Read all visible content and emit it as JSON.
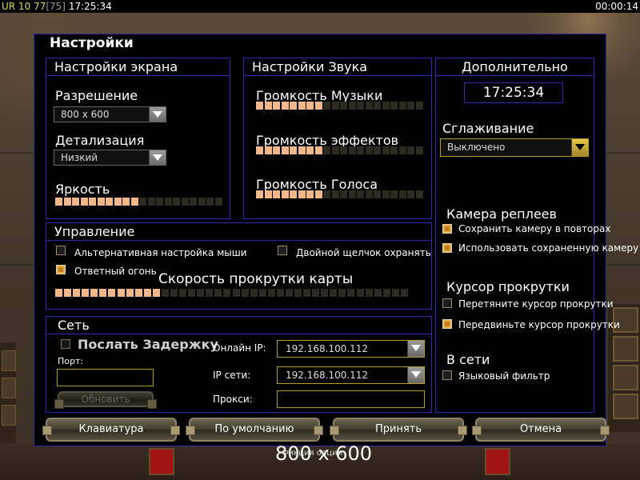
{
  "topbar": {
    "country": "UR",
    "num1": "10",
    "num2": "77",
    "num3": "[75]",
    "time_left": "17:25:34",
    "time_right": "00:00:14"
  },
  "dialog": {
    "title": "Настройки"
  },
  "screen": {
    "header": "Настройки экрана",
    "resolution_label": "Разрешение",
    "resolution_value": "800 x 600",
    "detail_label": "Детализация",
    "detail_value": "Низкий",
    "brightness_label": "Яркость",
    "brightness_level": 0.5
  },
  "sound": {
    "header": "Настройки Звука",
    "music_label": "Громкость Музыки",
    "music_level": 0.4,
    "effects_label": "Громкость эффектов",
    "effects_level": 0.4,
    "voice_label": "Громкость Голоса",
    "voice_level": 0.4
  },
  "extra": {
    "header": "Дополнительно",
    "clock": "17:25:34",
    "aa_label": "Сглаживание",
    "aa_value": "Выключено",
    "replay_cam_header": "Камера реплеев",
    "replay_opt1": "Сохранить камеру в повторах",
    "replay_opt2": "Использовать сохраненную камеру",
    "scroll_cursor_header": "Курсор прокрутки",
    "scroll_opt1": "Перетяните курсор прокрутки",
    "scroll_opt2": "Передвиньте курсор прокрутки",
    "online_header": "В сети",
    "lang_filter": "Языковый фильтр"
  },
  "control": {
    "header": "Управление",
    "alt_mouse": "Альтернативная настройка мыши",
    "double_click": "Двойной щелчок охранять",
    "return_fire": "Ответный огонь",
    "scroll_speed_label": "Скорость прокрутки карты",
    "scroll_speed_level": 0.3
  },
  "network": {
    "header": "Сеть",
    "send_delay": "Послать Задержку",
    "port_label": "Порт:",
    "refresh": "Обновить",
    "online_ip_label": "Онлайн IP:",
    "online_ip_value": "192.168.100.112",
    "lan_ip_label": "IP сети:",
    "lan_ip_value": "192.168.100.112",
    "proxy_label": "Прокси:"
  },
  "buttons": {
    "keyboard": "Клавиатура",
    "defaults": "По умолчанию",
    "accept": "Принять",
    "cancel": "Отмена"
  },
  "overlay": {
    "resolution_text": "800 x 600",
    "tooltip": "Фикция опции"
  },
  "colors": {
    "panel_border": "#2b2bb4",
    "slider_on": "#f2b88a",
    "accent_gold": "#e1ae4a"
  }
}
